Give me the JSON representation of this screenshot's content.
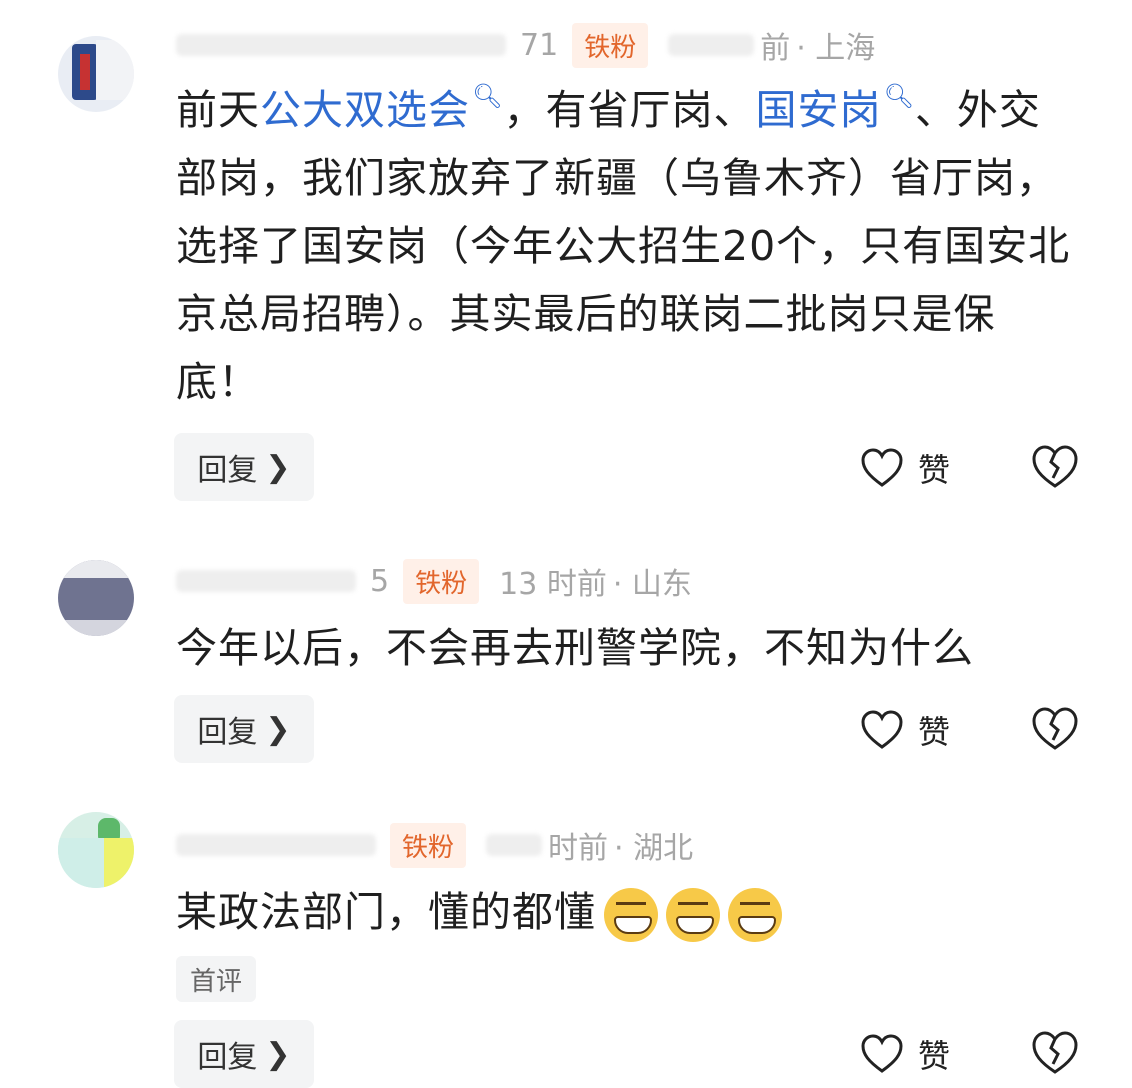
{
  "comments": [
    {
      "avatar_icon": "avatar-flag-icon",
      "username_fragment": "71",
      "badge": "铁粉",
      "time_fragment": "前",
      "location": "· 上海",
      "text_parts": [
        "前天",
        "公大双选会",
        "，有省厅岗、",
        "国安岗",
        "、外交部岗，我们家放弃了新疆（乌鲁木齐）省厅岗，选择了国安岗（今年公大招生20个，只有国安北京总局招聘）。其实最后的联岗二批岗只是保底！"
      ],
      "reply_label": "回复",
      "like_label": "赞"
    },
    {
      "avatar_icon": "avatar-gray-icon",
      "username_fragment": "5",
      "badge": "铁粉",
      "time_fragment": "13 时前",
      "location": "· 山东",
      "text": "今年以后，不会再去刑警学院，不知为什么",
      "reply_label": "回复",
      "like_label": "赞"
    },
    {
      "avatar_icon": "avatar-cartoon-icon",
      "username_fragment": "",
      "badge": "铁粉",
      "time_fragment": "时前",
      "location": "· 湖北",
      "text": "某政法部门，懂的都懂",
      "tag": "首评",
      "reply_label": "回复",
      "like_label": "赞"
    }
  ],
  "colors": {
    "link": "#2f6bd0",
    "badge_text": "#e2662c",
    "badge_bg": "#fff0e8"
  }
}
